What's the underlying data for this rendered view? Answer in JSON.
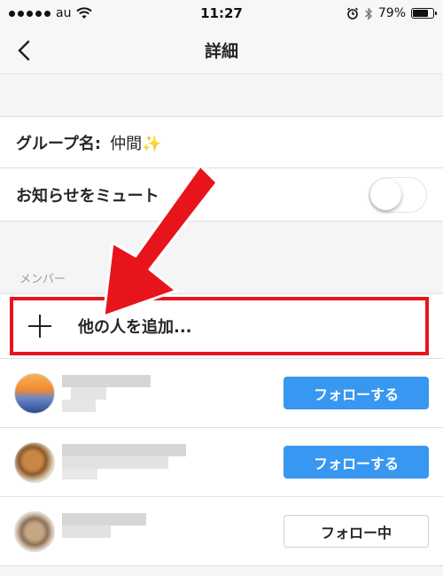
{
  "status_bar": {
    "carrier": "au",
    "time": "11:27",
    "battery": "79%",
    "battery_level": 0.79
  },
  "nav": {
    "title": "詳細"
  },
  "group": {
    "label": "グループ名:",
    "value": "仲間✨"
  },
  "mute": {
    "label": "お知らせをミュート",
    "enabled": false
  },
  "members_section": {
    "header": "メンバー"
  },
  "add_member": {
    "label": "他の人を追加..."
  },
  "members": [
    {
      "avatar": "sunset-avatar",
      "button_label": "フォローする",
      "button_state": "follow"
    },
    {
      "avatar": "dog-avatar",
      "button_label": "フォローする",
      "button_state": "follow"
    },
    {
      "avatar": "cat-avatar",
      "button_label": "フォロー中",
      "button_state": "following"
    }
  ],
  "colors": {
    "accent": "#3897f0",
    "annotation": "#e8141c"
  },
  "icons": {
    "back": "chevron-left-icon",
    "add": "plus-icon",
    "wifi": "wifi-icon",
    "alarm": "alarm-icon",
    "bluetooth": "bluetooth-icon",
    "battery": "battery-icon",
    "annotation": "red-arrow-icon"
  }
}
